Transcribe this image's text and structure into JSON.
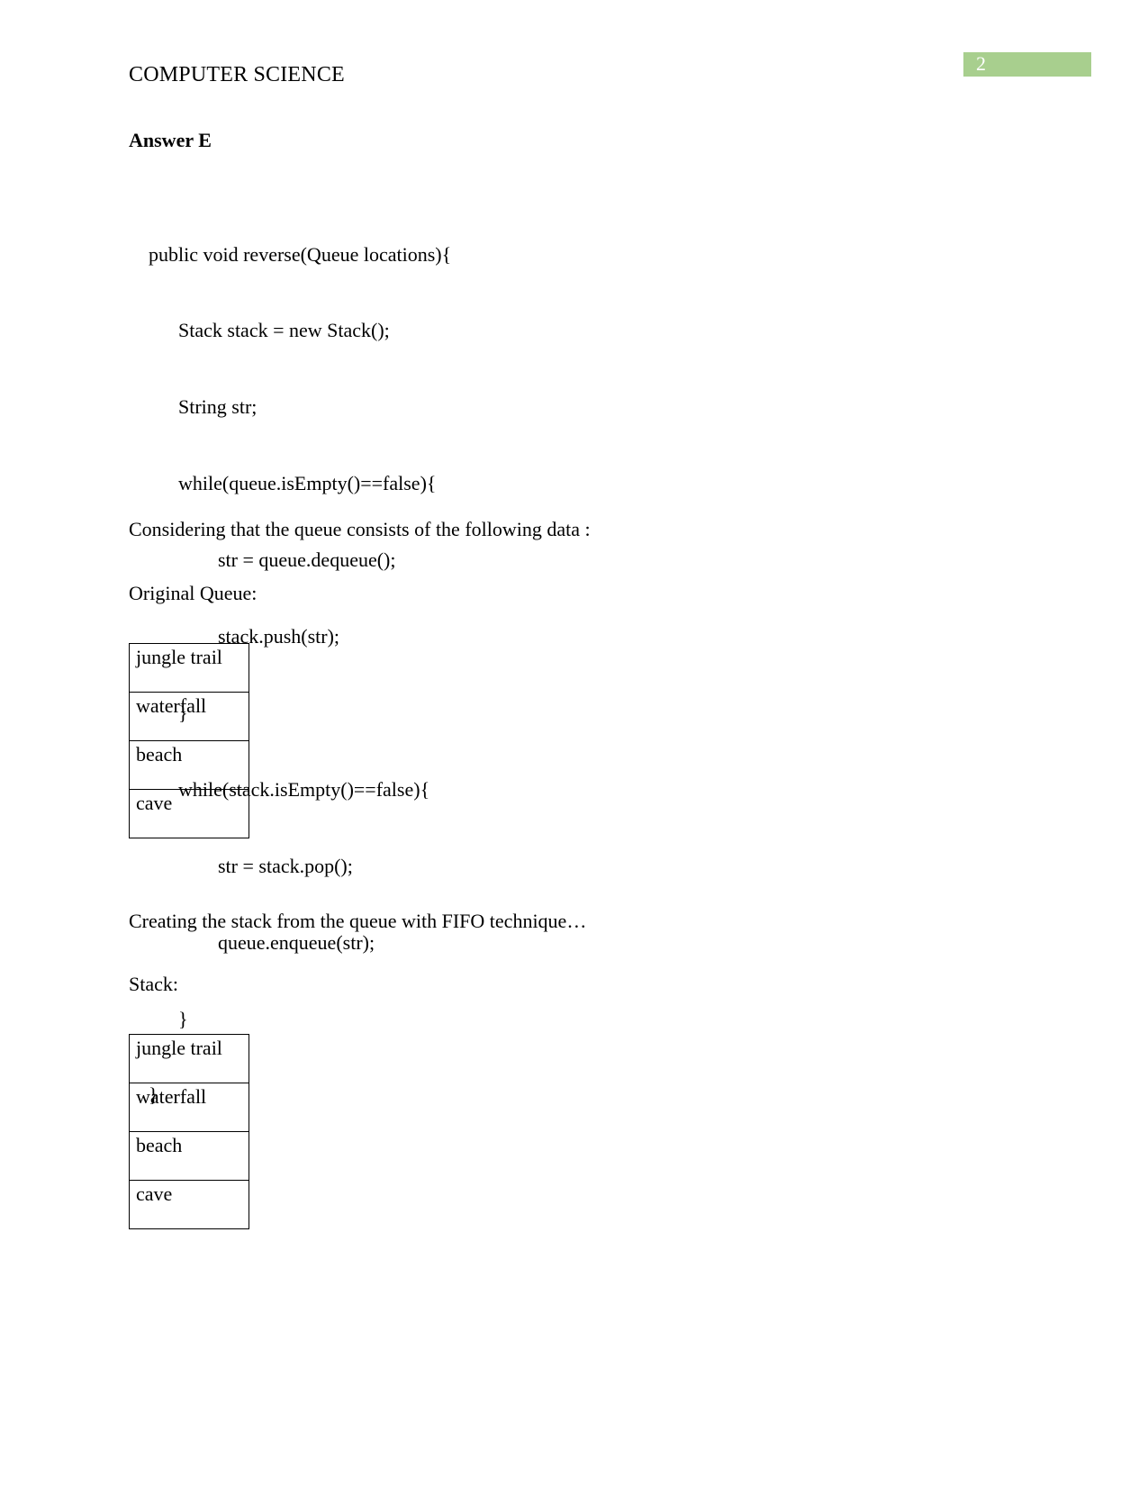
{
  "page": {
    "number_badge": "2",
    "badge_color": "#a8cf8e",
    "header": "COMPUTER SCIENCE"
  },
  "answer": {
    "heading": "Answer E"
  },
  "code": {
    "lines": [
      "    public void reverse(Queue locations){",
      "          Stack stack = new Stack();",
      "          String str;",
      "          while(queue.isEmpty()==false){",
      "                  str = queue.dequeue();",
      "                  stack.push(str);",
      "          }",
      "          while(stack.isEmpty()==false){",
      "                  str = stack.pop();",
      "                  queue.enqueue(str);",
      "          }",
      "    }"
    ]
  },
  "paragraphs": {
    "considering": "Considering that the queue consists of the following data :",
    "original_queue_label": "Original Queue:",
    "creating_stack": "Creating the stack from the queue with FIFO technique…",
    "stack_label": "Stack:"
  },
  "tables": {
    "original_queue": {
      "rows": [
        "jungle trail",
        "waterfall",
        "beach",
        "cave"
      ]
    },
    "stack": {
      "rows": [
        "jungle trail",
        "waterfall",
        "beach",
        "cave"
      ]
    }
  }
}
